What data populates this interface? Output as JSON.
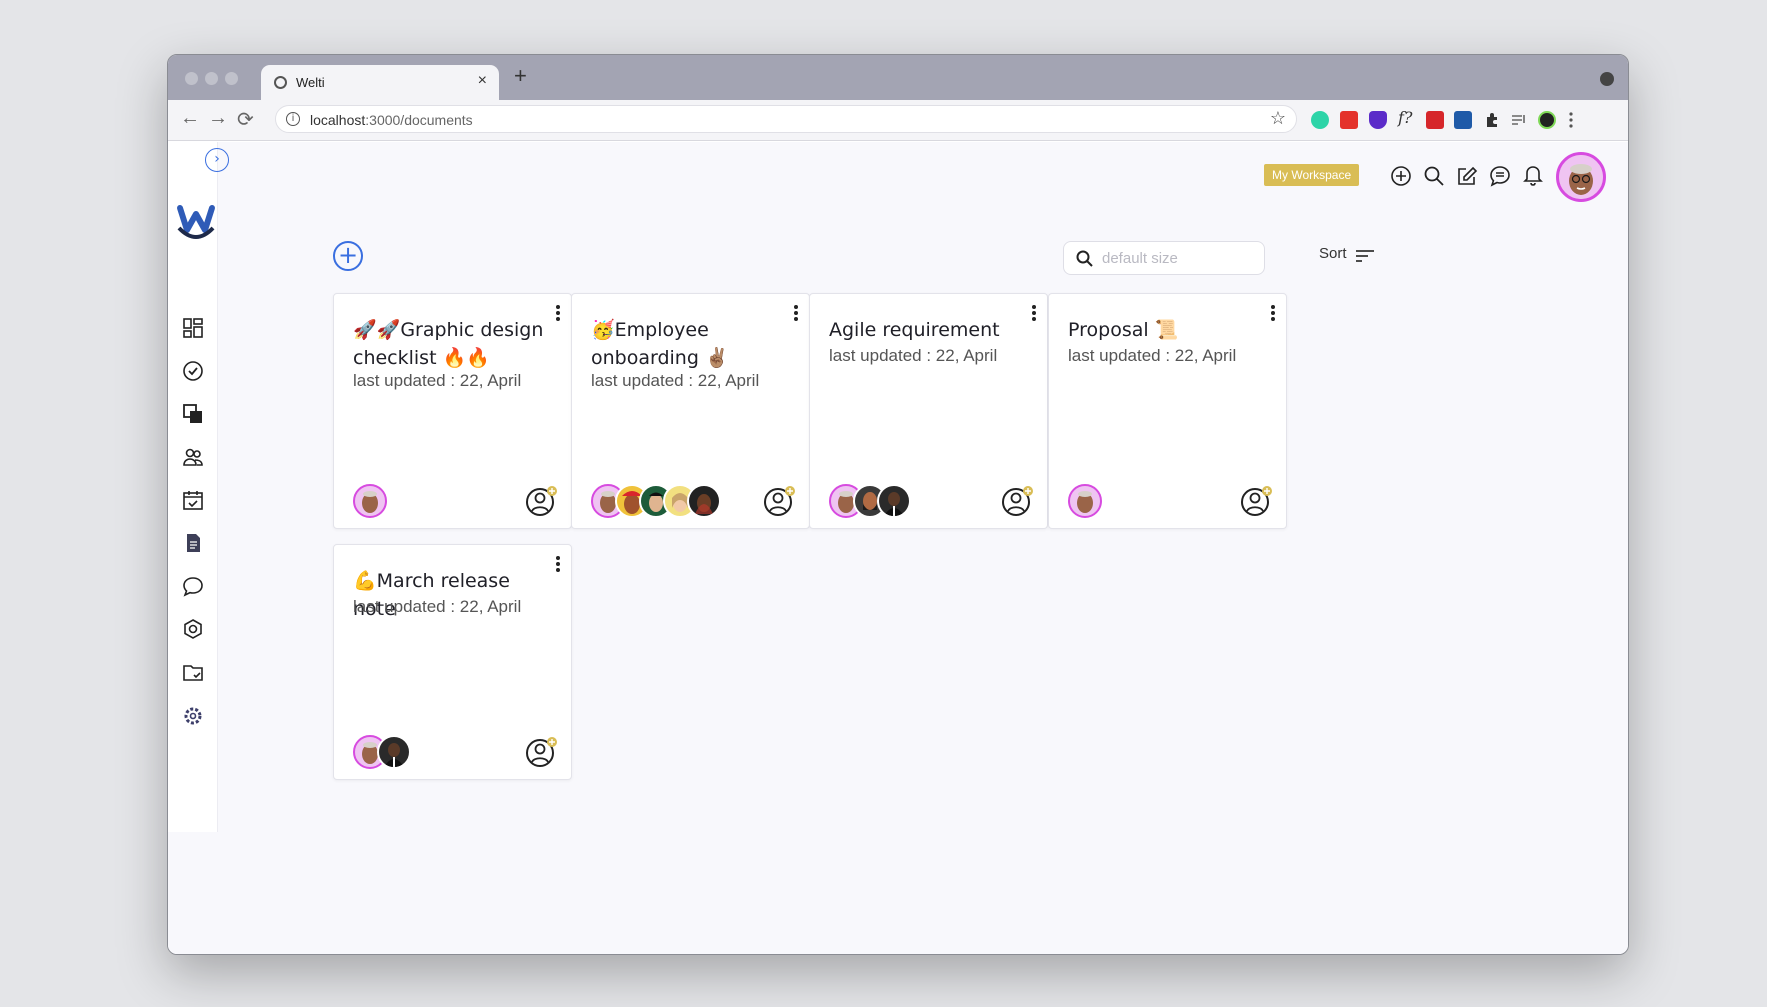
{
  "browser": {
    "tab_title": "Welti",
    "tab_close": "×",
    "new_tab": "+",
    "url_host": "localhost",
    "url_path": ":3000/documents",
    "nav": {
      "back": "←",
      "forward": "→",
      "reload": "⟳"
    },
    "star": "☆",
    "ext_fx": "f?"
  },
  "app": {
    "workspace_badge": "My Workspace",
    "expand_glyph": "›",
    "add_glyph": "+",
    "search_placeholder": "default size",
    "sort_label": "Sort",
    "sidebar_icons": [
      "dashboard-icon",
      "check-circle-icon",
      "copy-icon",
      "team-icon",
      "calendar-icon",
      "document-icon",
      "chat-icon",
      "lifebuoy-icon",
      "folder-check-icon",
      "gear-icon"
    ],
    "top_icons": [
      "add-circle-icon",
      "search-icon",
      "edit-icon",
      "message-icon",
      "bell-icon"
    ],
    "accent": "#3a6fe0",
    "badge_color": "#d9bd55",
    "avatar_ring": "#d74be0"
  },
  "documents": [
    {
      "title": "🚀🚀Graphic design checklist 🔥🔥",
      "updated": "last updated : 22, April",
      "members": 1
    },
    {
      "title": "🥳Employee onboarding ✌🏽",
      "updated": "last updated : 22, April",
      "members": 5
    },
    {
      "title": "Agile requirement",
      "updated": "last updated : 22, April",
      "members": 3
    },
    {
      "title": "Proposal 📜",
      "updated": "last updated : 22, April",
      "members": 1
    },
    {
      "title": "💪March release note",
      "updated": "last updated : 22, April",
      "members": 2
    }
  ]
}
